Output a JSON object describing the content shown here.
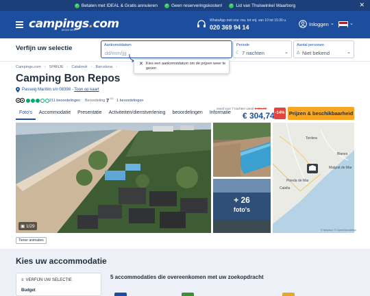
{
  "promo": {
    "items": [
      "Betalen met IDEAL & Gratis annuleren",
      "Geen reserveringskosten!",
      "Lid van Thuiswinkel Waarborg"
    ],
    "close_icon": "close-icon"
  },
  "header": {
    "logo_text": "campings",
    "logo_dot": ".",
    "logo_tld": "com",
    "logo_sub": "BEGIN HIER",
    "whatsapp_text": "WhatsApp met ons: ma. tot vrij. van 10 tot 15:30 u.",
    "phone": "020 369 94 14",
    "login": "Inloggen",
    "colors": {
      "brand": "#1d4e9e",
      "promo": "#1c3f7a",
      "accent": "#f6a623"
    }
  },
  "search": {
    "title": "Verfijn uw selectie",
    "arrival_label": "Aankomstdatum",
    "arrival_placeholder": "dd/mm/jjjj",
    "period_label": "Periode",
    "period_value": "7 nachten",
    "persons_label": "Aantal personen",
    "persons_value": "Niet bekend"
  },
  "tooltip": {
    "text": "Kies een aankomstdatum om de prijzen weer te geven"
  },
  "breadcrumb": [
    "Campings.com",
    "SPANJE",
    "Catalonië",
    "Barcelona"
  ],
  "campsite": {
    "name": "Camping Bon Repos",
    "address": "Passeig Marítim s/n 08398 -",
    "map_link": "Toon op kaart",
    "ta_reviews": "211 beoordelingen",
    "rating_label": "Beoordeling",
    "rating": "7",
    "rating_max": "/10",
    "reviews": "1 beoordelingen",
    "ta_bubbles": 3,
    "ta_bubbles_max": 5
  },
  "tabs": [
    "Foto's",
    "Accommodatie",
    "Presentatie",
    "Activiteiten/dienstverlening",
    "beoordelingen",
    "Informatie"
  ],
  "pricing": {
    "note": "vanaf voor 7 nachten vanaf",
    "old_price": "€ 355,53",
    "price": "€ 304,74",
    "discount": "-14%",
    "button": "Prijzen & beschikbaarheid"
  },
  "gallery": {
    "count": "1/29",
    "more": "+ 26",
    "more_label": "foto's"
  },
  "map": {
    "towns": [
      "Tordera",
      "Blanes",
      "Malgrat de Mar",
      "Pineda de Mar",
      "Calella"
    ],
    "attribution": "© Mapbox © OpenStreetMap"
  },
  "tag": "Tiener animaties",
  "accommodation": {
    "title": "Kies uw accommodatie",
    "filter_head": "VERFIJN UW SELECTIE",
    "budget": "Budget",
    "results": "5 accommodaties die overeenkomen met uw zoekopdracht"
  }
}
